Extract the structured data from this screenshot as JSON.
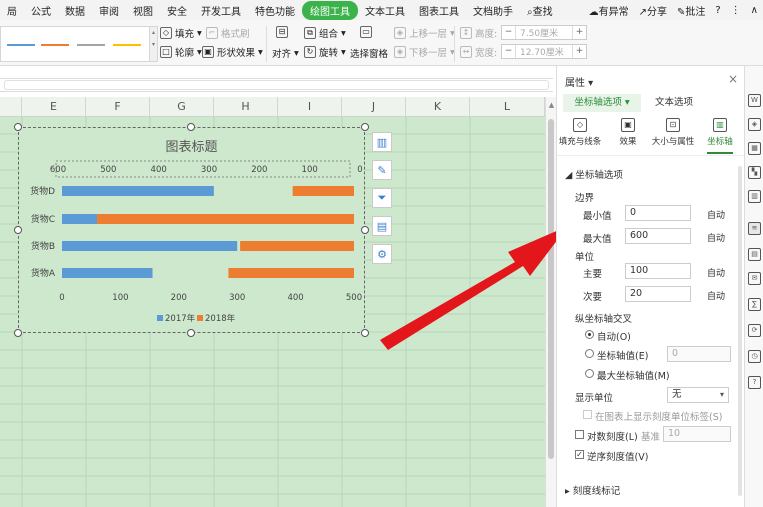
{
  "menu": {
    "items": [
      "局",
      "公式",
      "数据",
      "审阅",
      "视图",
      "安全",
      "开发工具",
      "特色功能",
      "绘图工具",
      "文本工具",
      "图表工具",
      "文档助手",
      "查找"
    ],
    "active": "绘图工具",
    "right": [
      "有异常",
      "分享",
      "批注",
      "?",
      "⋮",
      "∧"
    ]
  },
  "ribbon": {
    "fill": "填充",
    "format_painter": "格式刷",
    "outline": "轮廓",
    "shape_effect": "形状效果",
    "align": "对齐",
    "group": "组合",
    "rotate": "旋转",
    "selection_pane": "选择窗格",
    "bring_forward": "上移一层",
    "send_backward": "下移一层",
    "height_label": "高度:",
    "height_value": "7.50厘米",
    "width_label": "宽度:",
    "width_value": "12.70厘米"
  },
  "sheet": {
    "columns": [
      "E",
      "F",
      "G",
      "H",
      "I",
      "J",
      "K",
      "L"
    ]
  },
  "chart_data": {
    "type": "bar",
    "title": "图表标题",
    "categories": [
      "货物D",
      "货物C",
      "货物B",
      "货物A"
    ],
    "series": [
      {
        "name": "2017年",
        "values": [
          260,
          60,
          300,
          155
        ],
        "color": "#5b9bd5"
      },
      {
        "name": "2018年",
        "values": [
          105,
          440,
          195,
          215
        ],
        "color": "#ed7d31"
      }
    ],
    "bottom_axis_ticks": [
      "0",
      "100",
      "200",
      "300",
      "400",
      "500"
    ],
    "top_axis_ticks": [
      "600",
      "500",
      "400",
      "300",
      "200",
      "100",
      "0"
    ],
    "xlim": [
      0,
      500
    ],
    "legend": [
      "2017年",
      "2018年"
    ],
    "legend_position": "bottom",
    "grid": false
  },
  "pane": {
    "title": "属性",
    "close": "×",
    "tab_axis": "坐标轴选项",
    "tab_text": "文本选项",
    "icon_fill": "填充与线条",
    "icon_effect": "效果",
    "icon_size": "大小与属性",
    "icon_axis": "坐标轴",
    "section_axis": "坐标轴选项",
    "bounds": "边界",
    "min_label": "最小值",
    "min_value": "0",
    "max_label": "最大值",
    "max_value": "600",
    "auto": "自动",
    "units": "单位",
    "major_label": "主要",
    "major_value": "100",
    "minor_label": "次要",
    "minor_value": "20",
    "cross": "纵坐标轴交叉",
    "cross_auto": "自动(O)",
    "cross_value": "坐标轴值(E)",
    "cross_value_field": "0",
    "cross_max": "最大坐标轴值(M)",
    "display_units": "显示单位",
    "display_units_value": "无",
    "show_unit_label": "在图表上显示刻度单位标签(S)",
    "log_scale": "对数刻度(L)",
    "log_base_label": "基准",
    "log_base_value": "10",
    "reverse": "逆序刻度值(V)",
    "tick_marks": "刻度线标记"
  }
}
